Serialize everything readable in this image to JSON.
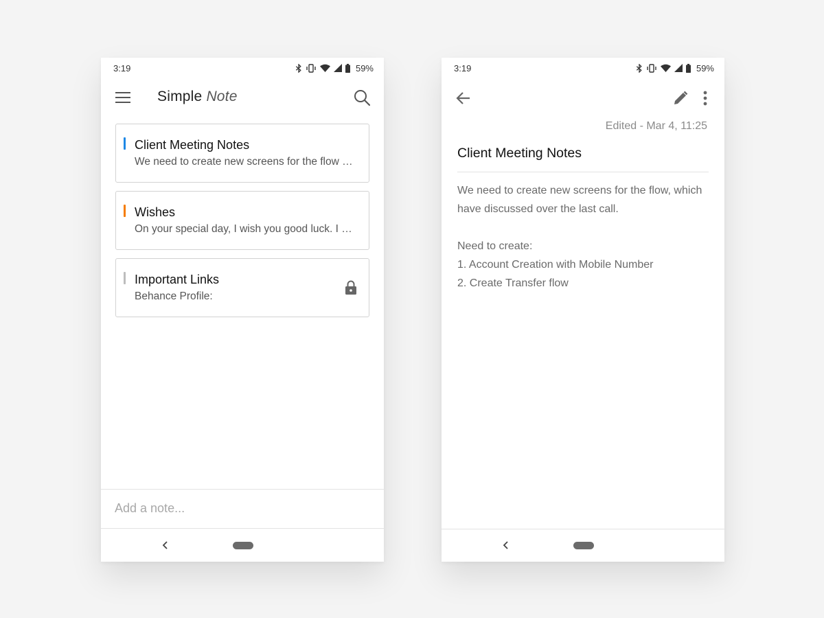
{
  "list_screen": {
    "status": {
      "time": "3:19",
      "battery": "59%"
    },
    "app_bar": {
      "title_regular": "Simple",
      "title_italic": "Note"
    },
    "notes": [
      {
        "title": "Client Meeting Notes",
        "preview": "We need to create new screens for the flow which have discussed over the last call.",
        "accent_color": "#1e88e5",
        "locked": false
      },
      {
        "title": "Wishes",
        "preview": "On your special day, I wish you good luck. I hope this wonderful day will fill up your heart.",
        "accent_color": "#f57c00",
        "locked": false
      },
      {
        "title": "Important Links",
        "preview": "Behance Profile:",
        "accent_color": "#bdbdbd",
        "locked": true
      }
    ],
    "add_note": {
      "placeholder": "Add a note..."
    }
  },
  "detail_screen": {
    "status": {
      "time": "3:19",
      "battery": "59%"
    },
    "edited": "Edited - Mar 4, 11:25",
    "title": "Client Meeting Notes",
    "body": {
      "line1": "We need to create new screens for the flow, which have discussed over the last call.",
      "line2": "Need to create:",
      "line3": "1. Account Creation with Mobile Number",
      "line4": "2. Create Transfer flow"
    }
  },
  "icons": {
    "status": [
      "bluetooth-icon",
      "vibrate-icon",
      "wifi-icon",
      "signal-icon",
      "battery-icon"
    ],
    "list": [
      "hamburger-menu-icon",
      "search-icon",
      "lock-icon"
    ],
    "detail": [
      "back-arrow-icon",
      "pencil-icon",
      "more-vertical-icon"
    ],
    "nav": [
      "nav-back-icon",
      "nav-home-pill"
    ]
  },
  "colors": {
    "background": "#f4f4f4",
    "card_border": "#d2d2d2",
    "accent_blue": "#1e88e5",
    "accent_orange": "#f57c00",
    "accent_gray": "#bdbdbd",
    "icon_gray": "#666666"
  }
}
